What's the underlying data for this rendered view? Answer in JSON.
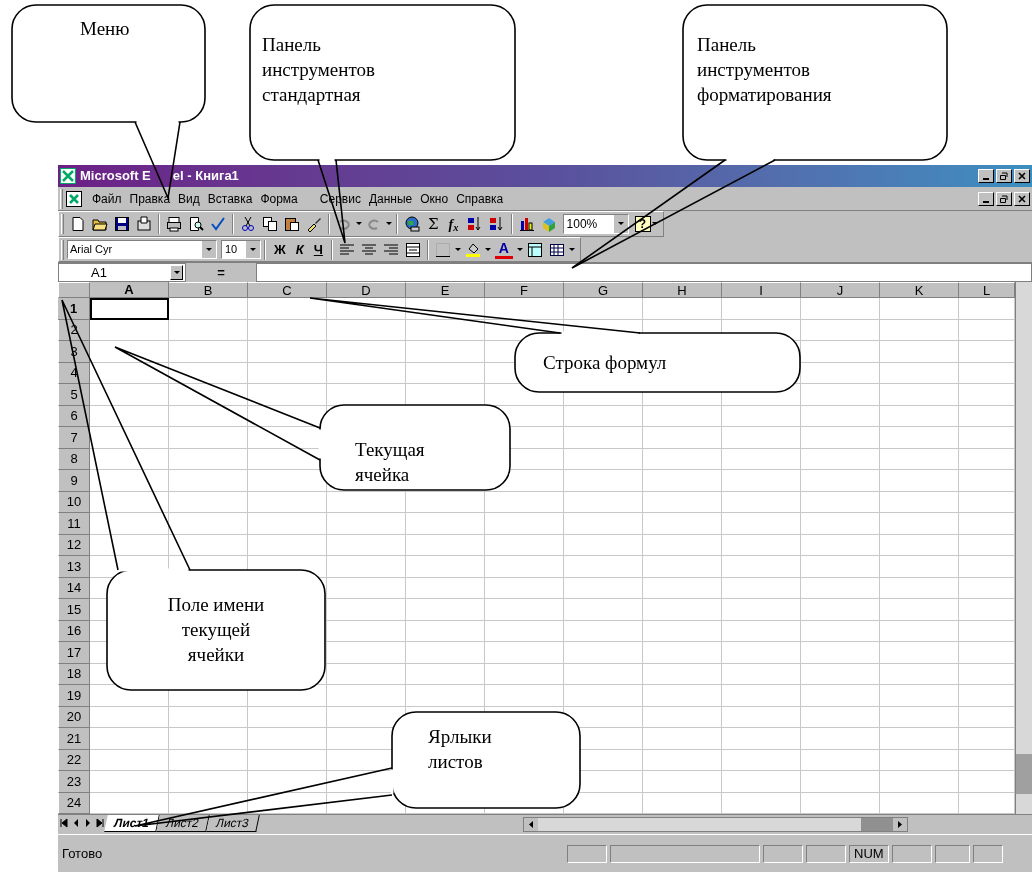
{
  "window": {
    "title": "Microsoft E",
    "title_continued": "el - Книга1"
  },
  "menu": [
    "Файл",
    "Правка",
    "Вид",
    "Вставка",
    "Форма",
    "Сервис",
    "Данные",
    "Окно",
    "Справка"
  ],
  "standard_toolbar": {
    "sigma": "Σ",
    "function": "f$_{x}$",
    "zoom": "100%",
    "help": "?"
  },
  "formatting_toolbar": {
    "font": "Arial Cyr",
    "size": "10",
    "bold": "Ж",
    "italic": "К",
    "underline": "Ч",
    "font_color": "A"
  },
  "formula_bar": {
    "name_box": "A1",
    "equals": "="
  },
  "grid": {
    "columns": [
      {
        "label": "A",
        "selected": true
      },
      {
        "label": "B",
        "selected": false
      },
      {
        "label": "C",
        "selected": false
      },
      {
        "label": "D",
        "selected": false
      },
      {
        "label": "E",
        "selected": false
      },
      {
        "label": "F",
        "selected": false
      },
      {
        "label": "G",
        "selected": false
      },
      {
        "label": "H",
        "selected": false
      },
      {
        "label": "I",
        "selected": false
      },
      {
        "label": "J",
        "selected": false
      },
      {
        "label": "K",
        "selected": false
      },
      {
        "label": "L",
        "selected": false
      }
    ],
    "rows": [
      {
        "label": "1",
        "selected": true
      },
      {
        "label": "2",
        "selected": false
      },
      {
        "label": "3",
        "selected": false
      },
      {
        "label": "4",
        "selected": false
      },
      {
        "label": "5",
        "selected": false
      },
      {
        "label": "6",
        "selected": false
      },
      {
        "label": "7",
        "selected": false
      },
      {
        "label": "8",
        "selected": false
      },
      {
        "label": "9",
        "selected": false
      },
      {
        "label": "10",
        "selected": false
      },
      {
        "label": "11",
        "selected": false
      },
      {
        "label": "12",
        "selected": false
      },
      {
        "label": "13",
        "selected": false
      },
      {
        "label": "14",
        "selected": false
      },
      {
        "label": "15",
        "selected": false
      },
      {
        "label": "16",
        "selected": false
      },
      {
        "label": "17",
        "selected": false
      },
      {
        "label": "18",
        "selected": false
      },
      {
        "label": "19",
        "selected": false
      },
      {
        "label": "20",
        "selected": false
      },
      {
        "label": "21",
        "selected": false
      },
      {
        "label": "22",
        "selected": false
      },
      {
        "label": "23",
        "selected": false
      },
      {
        "label": "24",
        "selected": false
      }
    ]
  },
  "sheet_tabs": [
    {
      "label": "Лист1",
      "selected": true
    },
    {
      "label": "Лист2",
      "selected": false
    },
    {
      "label": "Лист3",
      "selected": false
    }
  ],
  "status_bar": {
    "text": "Готово",
    "num": "NUM"
  },
  "callouts": [
    {
      "text": "Меню"
    },
    {
      "text": "Панель\nинструментов\nстандартная"
    },
    {
      "text": "Панель\nинструментов\nформатирования"
    },
    {
      "text": "Строка формул"
    },
    {
      "text": "Текущая\nячейка"
    },
    {
      "text": "Поле имени\nтекущей\nячейки"
    },
    {
      "text": "Ярлыки\nлистов"
    }
  ]
}
